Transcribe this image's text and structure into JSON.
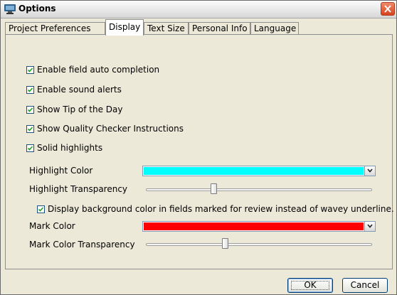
{
  "window": {
    "title": "Options"
  },
  "tabs": [
    {
      "label": "Project Preferences",
      "active": false
    },
    {
      "label": "Display",
      "active": true
    },
    {
      "label": "Text Size",
      "active": false
    },
    {
      "label": "Personal Info",
      "active": false
    },
    {
      "label": "Language",
      "active": false
    }
  ],
  "display": {
    "checkboxes": [
      {
        "label": "Enable field auto completion",
        "checked": true
      },
      {
        "label": "Enable sound alerts",
        "checked": true
      },
      {
        "label": "Show Tip of the Day",
        "checked": true
      },
      {
        "label": "Show Quality Checker Instructions",
        "checked": true
      },
      {
        "label": "Solid highlights",
        "checked": true
      }
    ],
    "highlight_color_label": "Highlight Color",
    "highlight_color": "#00ffff",
    "highlight_transparency_label": "Highlight Transparency",
    "highlight_transparency": 0.3,
    "review_background": {
      "label": "Display background color in fields marked for review instead of wavey underline.",
      "checked": true
    },
    "mark_color_label": "Mark Color",
    "mark_color": "#ff0000",
    "mark_transparency_label": "Mark Color Transparency",
    "mark_transparency": 0.35
  },
  "buttons": {
    "ok": "OK",
    "cancel": "Cancel"
  },
  "icons": {
    "app": "options-app-icon",
    "close": "close-icon",
    "dropdown": "chevron-down-icon",
    "check": "checkmark-icon"
  }
}
